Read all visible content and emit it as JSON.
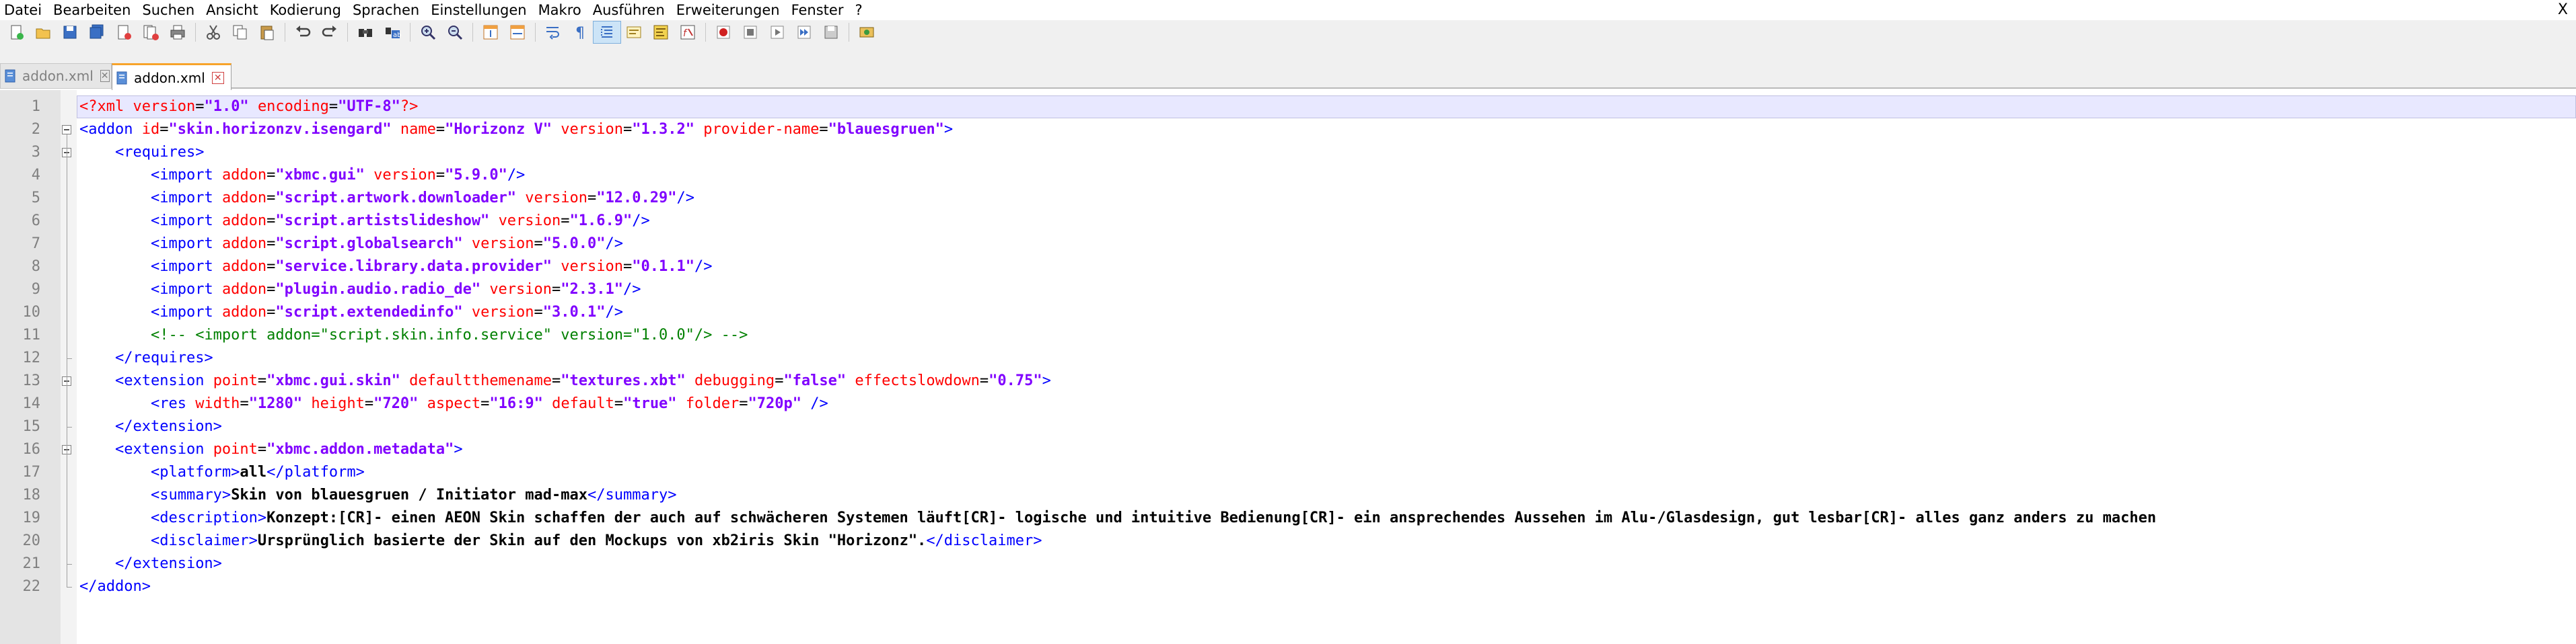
{
  "menu": [
    "Datei",
    "Bearbeiten",
    "Suchen",
    "Ansicht",
    "Kodierung",
    "Sprachen",
    "Einstellungen",
    "Makro",
    "Ausführen",
    "Erweiterungen",
    "Fenster",
    "?"
  ],
  "close_label": "X",
  "toolbar": {
    "buttons": [
      "new",
      "open",
      "save",
      "save-all",
      "close",
      "close-all",
      "print",
      "cut",
      "copy",
      "paste",
      "undo",
      "redo",
      "find",
      "replace",
      "zoom-in",
      "zoom-out",
      "sync-vertical",
      "sync-horizontal",
      "word-wrap",
      "show-all-chars",
      "indent-guide",
      "user-language",
      "document-map",
      "function-list",
      "record-macro",
      "stop-macro",
      "play-macro",
      "run-macro-multiple",
      "save-macro",
      "launch-in-browser"
    ],
    "active": [
      "indent-guide"
    ]
  },
  "tabs": [
    {
      "label": "addon.xml",
      "active": false
    },
    {
      "label": "addon.xml",
      "active": true
    }
  ],
  "colors": {
    "tag": "#0000ff",
    "attr": "#ff0000",
    "value": "#8000ff",
    "comment": "#008000",
    "text": "#000000",
    "pi": "#ff0000"
  },
  "editor": {
    "current_line": 1,
    "lines": [
      [
        [
          "pi",
          "<?xml "
        ],
        [
          "attr",
          "version"
        ],
        [
          "eq",
          "="
        ],
        [
          "val",
          "\"1.0\""
        ],
        [
          "pi",
          " "
        ],
        [
          "attr",
          "encoding"
        ],
        [
          "eq",
          "="
        ],
        [
          "val",
          "\"UTF-8\""
        ],
        [
          "pi",
          "?>"
        ]
      ],
      [
        [
          "tag",
          "<addon "
        ],
        [
          "attr",
          "id"
        ],
        [
          "eq",
          "="
        ],
        [
          "val",
          "\"skin.horizonzv.isengard\""
        ],
        [
          "tag",
          " "
        ],
        [
          "attr",
          "name"
        ],
        [
          "eq",
          "="
        ],
        [
          "val",
          "\"Horizonz V\""
        ],
        [
          "tag",
          " "
        ],
        [
          "attr",
          "version"
        ],
        [
          "eq",
          "="
        ],
        [
          "val",
          "\"1.3.2\""
        ],
        [
          "tag",
          " "
        ],
        [
          "attr",
          "provider-name"
        ],
        [
          "eq",
          "="
        ],
        [
          "val",
          "\"blauesgruen\""
        ],
        [
          "tag",
          ">"
        ]
      ],
      [
        [
          "txt",
          "    "
        ],
        [
          "tag",
          "<requires>"
        ]
      ],
      [
        [
          "txt",
          "        "
        ],
        [
          "tag",
          "<import "
        ],
        [
          "attr",
          "addon"
        ],
        [
          "eq",
          "="
        ],
        [
          "val",
          "\"xbmc.gui\""
        ],
        [
          "tag",
          " "
        ],
        [
          "attr",
          "version"
        ],
        [
          "eq",
          "="
        ],
        [
          "val",
          "\"5.9.0\""
        ],
        [
          "tag",
          "/>"
        ]
      ],
      [
        [
          "txt",
          "        "
        ],
        [
          "tag",
          "<import "
        ],
        [
          "attr",
          "addon"
        ],
        [
          "eq",
          "="
        ],
        [
          "val",
          "\"script.artwork.downloader\""
        ],
        [
          "tag",
          " "
        ],
        [
          "attr",
          "version"
        ],
        [
          "eq",
          "="
        ],
        [
          "val",
          "\"12.0.29\""
        ],
        [
          "tag",
          "/>"
        ]
      ],
      [
        [
          "txt",
          "        "
        ],
        [
          "tag",
          "<import "
        ],
        [
          "attr",
          "addon"
        ],
        [
          "eq",
          "="
        ],
        [
          "val",
          "\"script.artistslideshow\""
        ],
        [
          "tag",
          " "
        ],
        [
          "attr",
          "version"
        ],
        [
          "eq",
          "="
        ],
        [
          "val",
          "\"1.6.9\""
        ],
        [
          "tag",
          "/>"
        ]
      ],
      [
        [
          "txt",
          "        "
        ],
        [
          "tag",
          "<import "
        ],
        [
          "attr",
          "addon"
        ],
        [
          "eq",
          "="
        ],
        [
          "val",
          "\"script.globalsearch\""
        ],
        [
          "tag",
          " "
        ],
        [
          "attr",
          "version"
        ],
        [
          "eq",
          "="
        ],
        [
          "val",
          "\"5.0.0\""
        ],
        [
          "tag",
          "/>"
        ]
      ],
      [
        [
          "txt",
          "        "
        ],
        [
          "tag",
          "<import "
        ],
        [
          "attr",
          "addon"
        ],
        [
          "eq",
          "="
        ],
        [
          "val",
          "\"service.library.data.provider\""
        ],
        [
          "tag",
          " "
        ],
        [
          "attr",
          "version"
        ],
        [
          "eq",
          "="
        ],
        [
          "val",
          "\"0.1.1\""
        ],
        [
          "tag",
          "/>"
        ]
      ],
      [
        [
          "txt",
          "        "
        ],
        [
          "tag",
          "<import "
        ],
        [
          "attr",
          "addon"
        ],
        [
          "eq",
          "="
        ],
        [
          "val",
          "\"plugin.audio.radio_de\""
        ],
        [
          "tag",
          " "
        ],
        [
          "attr",
          "version"
        ],
        [
          "eq",
          "="
        ],
        [
          "val",
          "\"2.3.1\""
        ],
        [
          "tag",
          "/>"
        ]
      ],
      [
        [
          "txt",
          "        "
        ],
        [
          "tag",
          "<import "
        ],
        [
          "attr",
          "addon"
        ],
        [
          "eq",
          "="
        ],
        [
          "val",
          "\"script.extendedinfo\""
        ],
        [
          "tag",
          " "
        ],
        [
          "attr",
          "version"
        ],
        [
          "eq",
          "="
        ],
        [
          "val",
          "\"3.0.1\""
        ],
        [
          "tag",
          "/>"
        ]
      ],
      [
        [
          "txt",
          "        "
        ],
        [
          "cmt",
          "<!-- <import addon=\"script.skin.info.service\" version=\"1.0.0\"/> -->"
        ]
      ],
      [
        [
          "txt",
          "    "
        ],
        [
          "tag",
          "</requires>"
        ]
      ],
      [
        [
          "txt",
          "    "
        ],
        [
          "tag",
          "<extension "
        ],
        [
          "attr",
          "point"
        ],
        [
          "eq",
          "="
        ],
        [
          "val",
          "\"xbmc.gui.skin\""
        ],
        [
          "tag",
          " "
        ],
        [
          "attr",
          "defaultthemename"
        ],
        [
          "eq",
          "="
        ],
        [
          "val",
          "\"textures.xbt\""
        ],
        [
          "tag",
          " "
        ],
        [
          "attr",
          "debugging"
        ],
        [
          "eq",
          "="
        ],
        [
          "val",
          "\"false\""
        ],
        [
          "tag",
          " "
        ],
        [
          "attr",
          "effectslowdown"
        ],
        [
          "eq",
          "="
        ],
        [
          "val",
          "\"0.75\""
        ],
        [
          "tag",
          ">"
        ]
      ],
      [
        [
          "txt",
          "        "
        ],
        [
          "tag",
          "<res "
        ],
        [
          "attr",
          "width"
        ],
        [
          "eq",
          "="
        ],
        [
          "val",
          "\"1280\""
        ],
        [
          "tag",
          " "
        ],
        [
          "attr",
          "height"
        ],
        [
          "eq",
          "="
        ],
        [
          "val",
          "\"720\""
        ],
        [
          "tag",
          " "
        ],
        [
          "attr",
          "aspect"
        ],
        [
          "eq",
          "="
        ],
        [
          "val",
          "\"16:9\""
        ],
        [
          "tag",
          " "
        ],
        [
          "attr",
          "default"
        ],
        [
          "eq",
          "="
        ],
        [
          "val",
          "\"true\""
        ],
        [
          "tag",
          " "
        ],
        [
          "attr",
          "folder"
        ],
        [
          "eq",
          "="
        ],
        [
          "val",
          "\"720p\""
        ],
        [
          "tag",
          " />"
        ]
      ],
      [
        [
          "txt",
          "    "
        ],
        [
          "tag",
          "</extension>"
        ]
      ],
      [
        [
          "txt",
          "    "
        ],
        [
          "tag",
          "<extension "
        ],
        [
          "attr",
          "point"
        ],
        [
          "eq",
          "="
        ],
        [
          "val",
          "\"xbmc.addon.metadata\""
        ],
        [
          "tag",
          ">"
        ]
      ],
      [
        [
          "txt",
          "        "
        ],
        [
          "tag",
          "<platform>"
        ],
        [
          "txt",
          "all"
        ],
        [
          "tag",
          "</platform>"
        ]
      ],
      [
        [
          "txt",
          "        "
        ],
        [
          "tag",
          "<summary>"
        ],
        [
          "txt",
          "Skin von blauesgruen / Initiator mad-max"
        ],
        [
          "tag",
          "</summary>"
        ]
      ],
      [
        [
          "txt",
          "        "
        ],
        [
          "tag",
          "<description>"
        ],
        [
          "txt",
          "Konzept:[CR]- einen AEON Skin schaffen der auch auf schwächeren Systemen läuft[CR]- logische und intuitive Bedienung[CR]- ein ansprechendes Aussehen im Alu-/Glasdesign, gut lesbar[CR]- alles ganz anders zu machen"
        ]
      ],
      [
        [
          "txt",
          "        "
        ],
        [
          "tag",
          "<disclaimer>"
        ],
        [
          "txt",
          "Ursprünglich basierte der Skin auf den Mockups von xb2iris Skin \"Horizonz\"."
        ],
        [
          "tag",
          "</disclaimer>"
        ]
      ],
      [
        [
          "txt",
          "    "
        ],
        [
          "tag",
          "</extension>"
        ]
      ],
      [
        [
          "tag",
          "</addon>"
        ]
      ]
    ]
  }
}
